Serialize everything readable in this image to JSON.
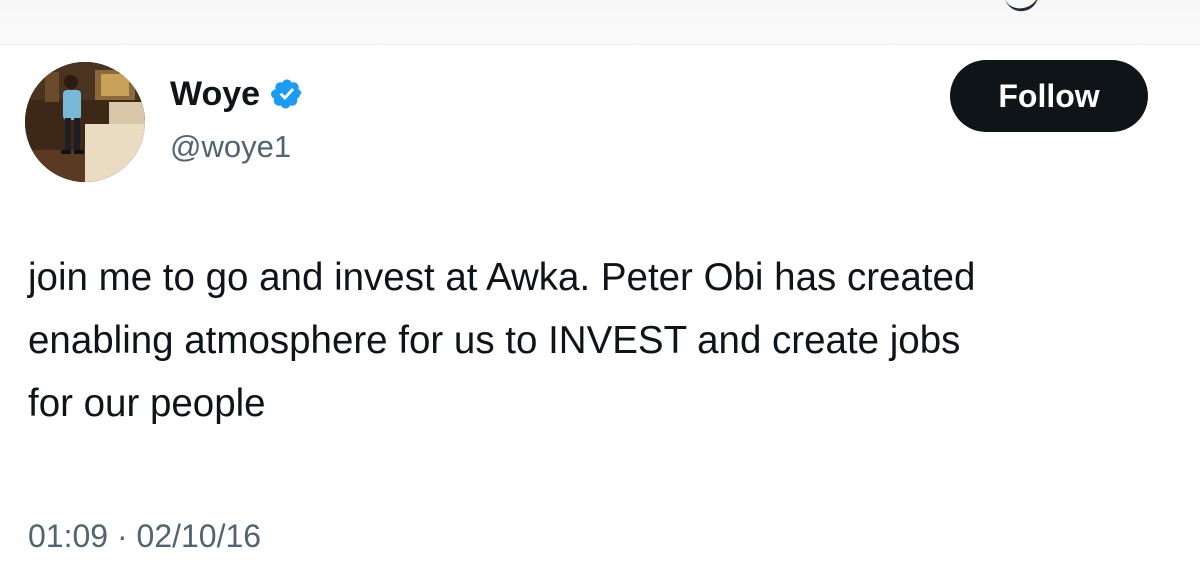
{
  "tweet": {
    "author": {
      "display_name": "Woye",
      "handle": "@woye1",
      "verified": true,
      "verified_badge_color": "#1d9bf0"
    },
    "follow_button_label": "Follow",
    "text": "join me to go and invest at Awka. Peter Obi has created\nenabling atmosphere for us to INVEST and create jobs\nfor our people",
    "time": "01:09",
    "separator": "·",
    "date": "02/10/16"
  },
  "colors": {
    "text_primary": "#0f1419",
    "text_secondary": "#536471",
    "follow_button_bg": "#0f1419",
    "follow_button_text": "#ffffff"
  }
}
